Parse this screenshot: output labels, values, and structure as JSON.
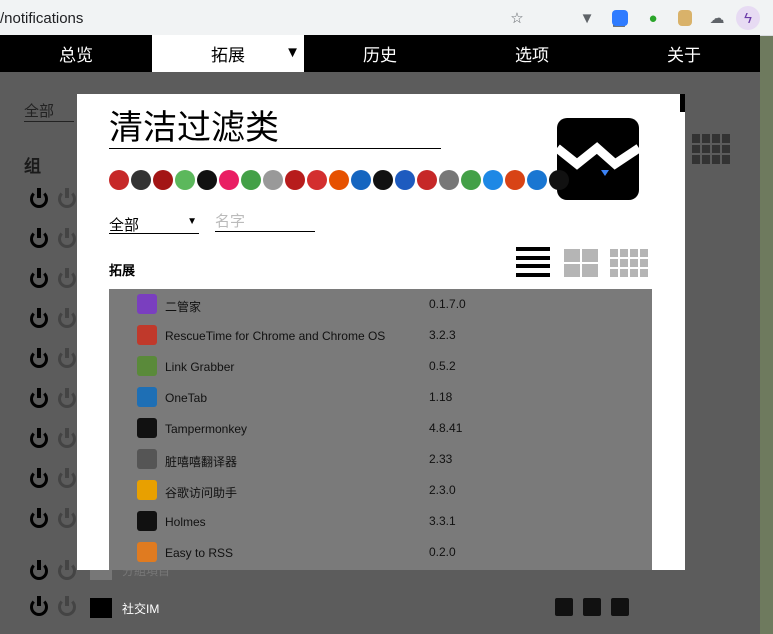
{
  "browser": {
    "url": "/notifications"
  },
  "topnav": {
    "tabs": [
      {
        "label": "总览"
      },
      {
        "label": "拓展"
      },
      {
        "label": "历史"
      },
      {
        "label": "选项"
      },
      {
        "label": "关于"
      }
    ],
    "active_index": 1
  },
  "background": {
    "filter_label": "全部",
    "group_heading": "组",
    "bottom_group_label": "社交IM",
    "partial_group_label": "分組項目"
  },
  "modal": {
    "title": "清洁过滤类",
    "filter_select": "全部",
    "name_placeholder": "名字",
    "section_title": "拓展",
    "extensions": [
      {
        "name": "二管家",
        "version": "0.1.7.0",
        "icon": "erguanjia-icon",
        "color": "#7a3fbf"
      },
      {
        "name": "RescueTime for Chrome and Chrome OS",
        "version": "3.2.3",
        "icon": "rescuetime-icon",
        "color": "#c0392b"
      },
      {
        "name": "Link Grabber",
        "version": "0.5.2",
        "icon": "link-grabber-icon",
        "color": "#5a8a3a"
      },
      {
        "name": "OneTab",
        "version": "1.18",
        "icon": "onetab-icon",
        "color": "#1e6fb5"
      },
      {
        "name": "Tampermonkey",
        "version": "4.8.41",
        "icon": "tampermonkey-icon",
        "color": "#111111"
      },
      {
        "name": "脏嘻嘻翻译器",
        "version": "2.33",
        "icon": "hand-icon",
        "color": "#555555"
      },
      {
        "name": "谷歌访问助手",
        "version": "2.3.0",
        "icon": "google-helper-icon",
        "color": "#e8a000"
      },
      {
        "name": "Holmes",
        "version": "3.3.1",
        "icon": "holmes-icon",
        "color": "#111111"
      },
      {
        "name": "Easy to RSS",
        "version": "0.2.0",
        "icon": "rss-icon",
        "color": "#e07b20"
      }
    ]
  }
}
